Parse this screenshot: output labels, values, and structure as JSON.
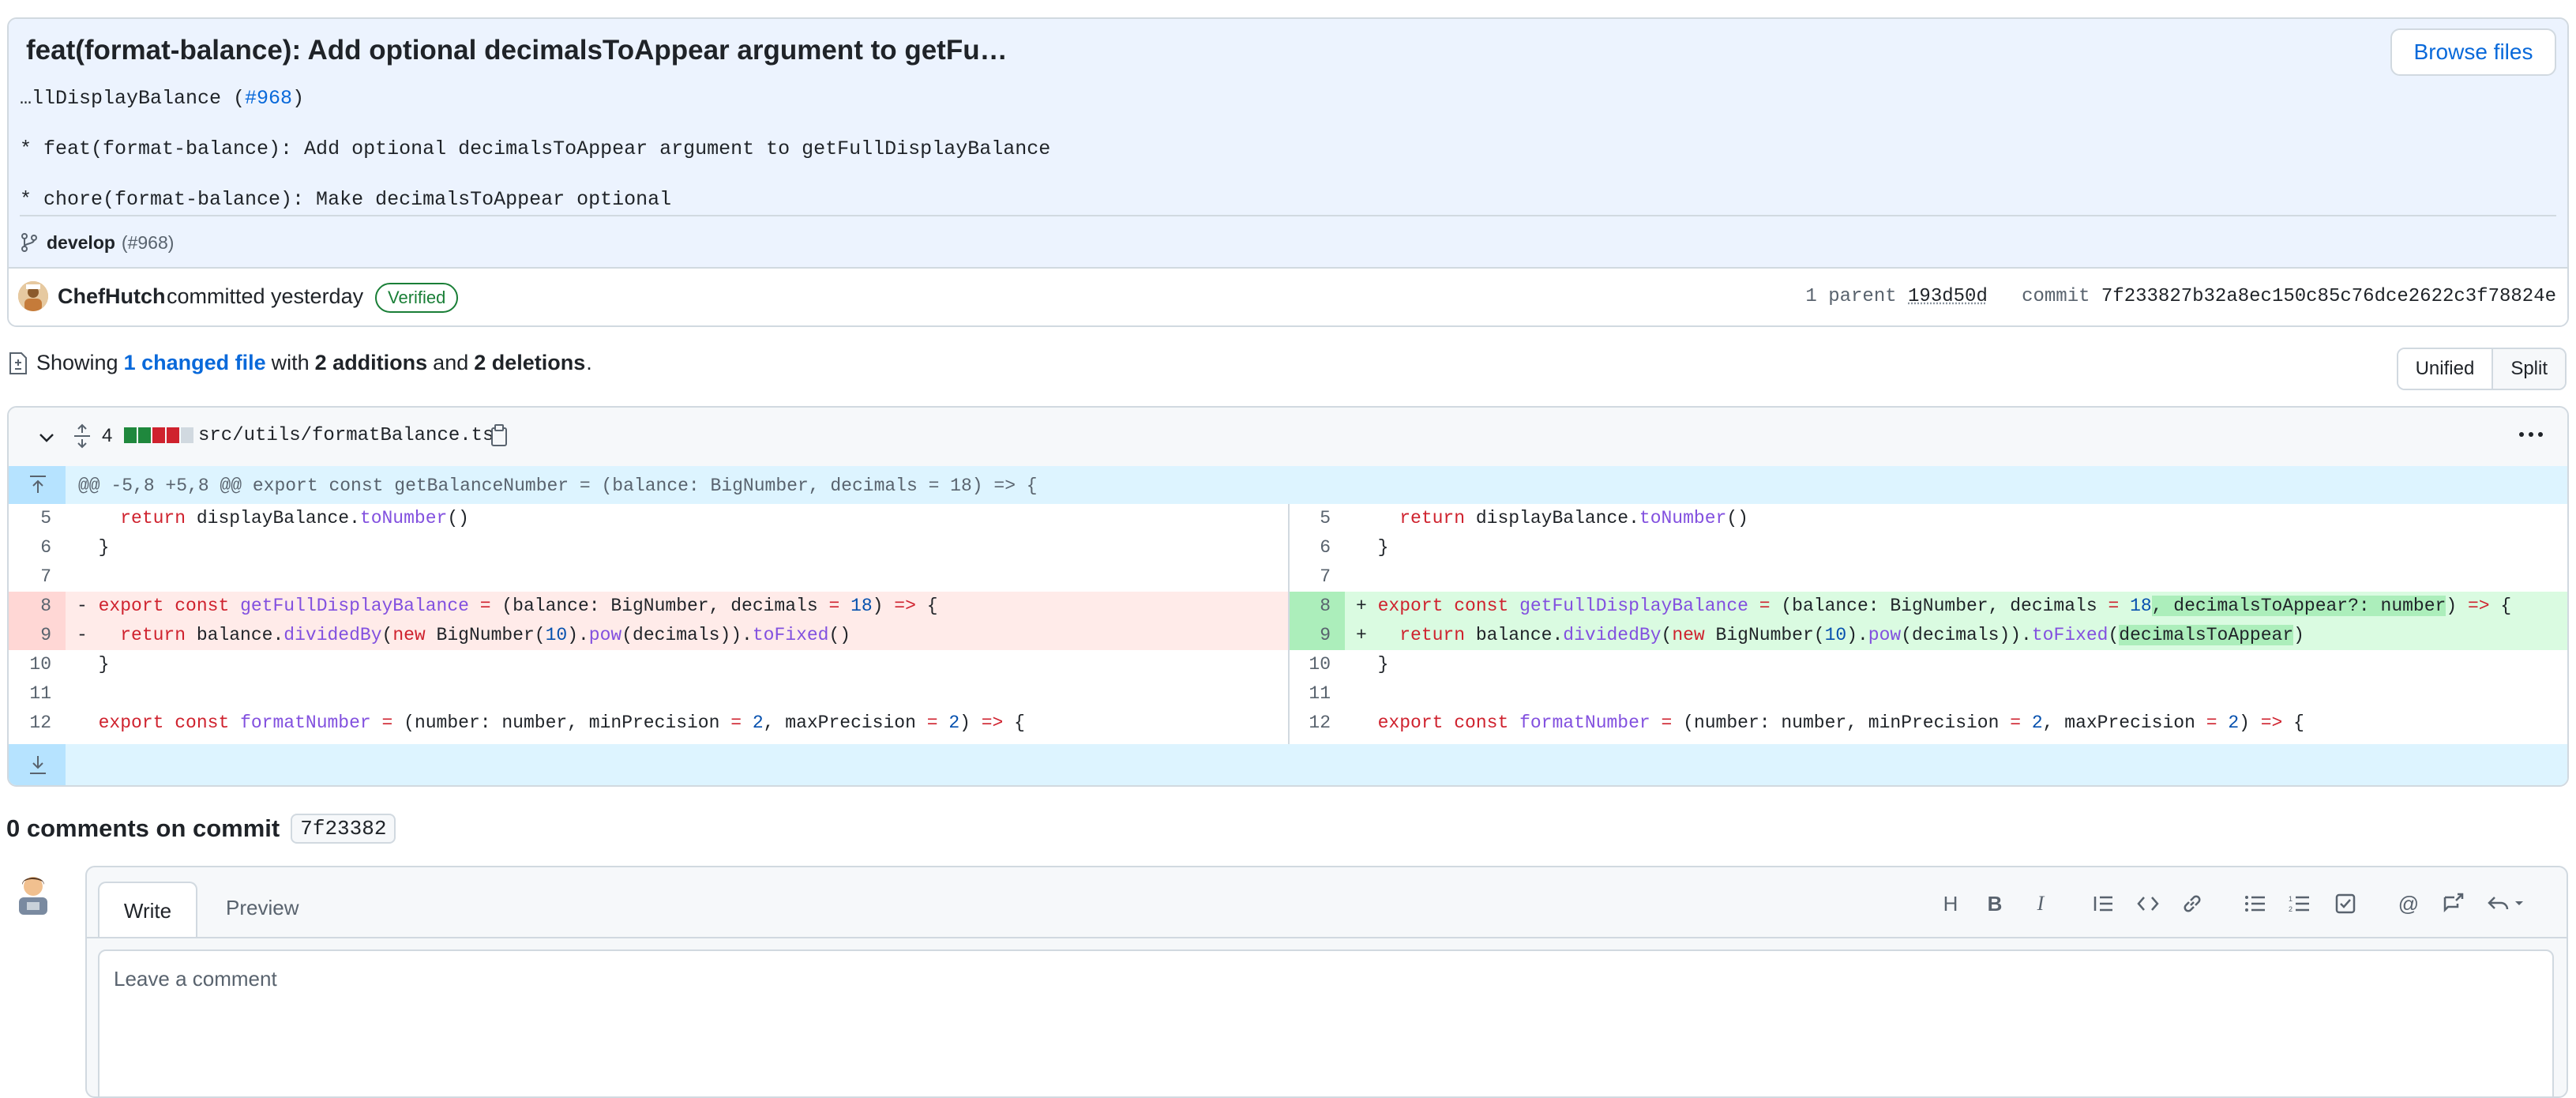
{
  "commit": {
    "title": "feat(format-balance): Add optional decimalsToAppear argument to getFu…",
    "browse_files": "Browse files",
    "message_line1_prefix": "…llDisplayBalance (",
    "message_line1_pr": "#968",
    "message_line1_suffix": ")",
    "message_line2": "* feat(format-balance): Add optional decimalsToAppear argument to getFullDisplayBalance",
    "message_line3": "* chore(format-balance): Make decimalsToAppear optional",
    "branch": "develop",
    "branch_pr": "(#968)",
    "author": "ChefHutch",
    "committed": "committed yesterday",
    "verified": "Verified",
    "parent_label": "1 parent",
    "parent_hash": "193d50d",
    "commit_label": "commit",
    "commit_hash": "7f233827b32a8ec150c85c76dce2622c3f78824e"
  },
  "summary": {
    "showing": "Showing",
    "changed_files": "1 changed file",
    "with": "with",
    "additions": "2 additions",
    "and": "and",
    "deletions": "2 deletions",
    "period": "."
  },
  "view_toggle": {
    "unified": "Unified",
    "split": "Split"
  },
  "diff": {
    "change_count": "4",
    "file_path": "src/utils/formatBalance.ts",
    "hunk_header": "@@ -5,8 +5,8 @@ export const getBalanceNumber = (balance: BigNumber, decimals = 18) => {",
    "lines": {
      "l5": "5",
      "l6": "6",
      "l7": "7",
      "l8": "8",
      "l9": "9",
      "l10": "10",
      "l11": "11",
      "l12": "12"
    }
  },
  "comments": {
    "heading": "0 comments on commit",
    "commit_short": "7f23382",
    "tab_write": "Write",
    "tab_preview": "Preview",
    "placeholder": "Leave a comment"
  },
  "colors": {
    "accent": "#0969da",
    "verified": "#1a7f37",
    "deletion": "#ffebe9",
    "addition": "#dafbe1"
  }
}
